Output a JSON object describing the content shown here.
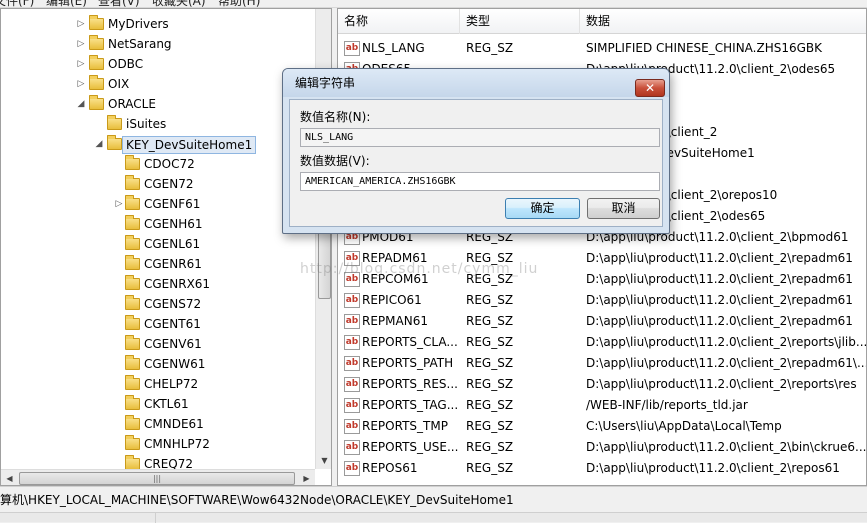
{
  "menu": {
    "items": [
      "文件(F)",
      "编辑(E)",
      "查看(V)",
      "收藏夹(A)",
      "帮助(H)"
    ]
  },
  "tree": {
    "items": [
      {
        "label": "MyDrivers",
        "arrow": "▷"
      },
      {
        "label": "NetSarang",
        "arrow": "▷"
      },
      {
        "label": "ODBC",
        "arrow": "▷"
      },
      {
        "label": "OIX",
        "arrow": "▷"
      },
      {
        "label": "ORACLE",
        "arrow": "◢"
      },
      {
        "label": "iSuites",
        "arrow": ""
      },
      {
        "label": "KEY_DevSuiteHome1",
        "arrow": "◢"
      },
      {
        "label": "CDOC72",
        "arrow": ""
      },
      {
        "label": "CGEN72",
        "arrow": ""
      },
      {
        "label": "CGENF61",
        "arrow": "▷"
      },
      {
        "label": "CGENH61",
        "arrow": ""
      },
      {
        "label": "CGENL61",
        "arrow": ""
      },
      {
        "label": "CGENR61",
        "arrow": ""
      },
      {
        "label": "CGENRX61",
        "arrow": ""
      },
      {
        "label": "CGENS72",
        "arrow": ""
      },
      {
        "label": "CGENT61",
        "arrow": ""
      },
      {
        "label": "CGENV61",
        "arrow": ""
      },
      {
        "label": "CGENW61",
        "arrow": ""
      },
      {
        "label": "CHELP72",
        "arrow": ""
      },
      {
        "label": "CKTL61",
        "arrow": ""
      },
      {
        "label": "CMNDE61",
        "arrow": ""
      },
      {
        "label": "CMNHLP72",
        "arrow": ""
      },
      {
        "label": "CREQ72",
        "arrow": ""
      }
    ],
    "hscroll_grip": "|||"
  },
  "list": {
    "columns": [
      "名称",
      "类型",
      "数据"
    ],
    "rows": [
      {
        "name": "NLS_LANG",
        "type": "REG_SZ",
        "data": "SIMPLIFIED CHINESE_CHINA.ZHS16GBK"
      },
      {
        "name": "ODES65",
        "type": "",
        "data": "D:\\app\\liu\\product\\11.2.0\\client_2\\odes65"
      },
      {
        "name": "",
        "type": "",
        "data": ""
      },
      {
        "name": "",
        "type": "",
        "data": "iteHome1"
      },
      {
        "name": "",
        "type": "",
        "data": "roduct\\11.2.0\\client_2"
      },
      {
        "name": "",
        "type": "",
        "data": "RACLE\\KEY_DevSuiteHome1"
      },
      {
        "name": "",
        "type": "",
        "data": ""
      },
      {
        "name": "",
        "type": "",
        "data": "roduct\\11.2.0\\client_2\\orepos10"
      },
      {
        "name": "",
        "type": "",
        "data": "roduct\\11.2.0\\client_2\\odes65"
      },
      {
        "name": "PMOD61",
        "type": "REG_SZ",
        "data": "D:\\app\\liu\\product\\11.2.0\\client_2\\bpmod61"
      },
      {
        "name": "REPADM61",
        "type": "REG_SZ",
        "data": "D:\\app\\liu\\product\\11.2.0\\client_2\\repadm61"
      },
      {
        "name": "REPCOM61",
        "type": "REG_SZ",
        "data": "D:\\app\\liu\\product\\11.2.0\\client_2\\repadm61"
      },
      {
        "name": "REPICO61",
        "type": "REG_SZ",
        "data": "D:\\app\\liu\\product\\11.2.0\\client_2\\repadm61"
      },
      {
        "name": "REPMAN61",
        "type": "REG_SZ",
        "data": "D:\\app\\liu\\product\\11.2.0\\client_2\\repadm61"
      },
      {
        "name": "REPORTS_CLA...",
        "type": "REG_SZ",
        "data": "D:\\app\\liu\\product\\11.2.0\\client_2\\reports\\jlib..."
      },
      {
        "name": "REPORTS_PATH",
        "type": "REG_SZ",
        "data": "D:\\app\\liu\\product\\11.2.0\\client_2\\repadm61\\..."
      },
      {
        "name": "REPORTS_RES...",
        "type": "REG_SZ",
        "data": "D:\\app\\liu\\product\\11.2.0\\client_2\\reports\\res"
      },
      {
        "name": "REPORTS_TAG...",
        "type": "REG_SZ",
        "data": "/WEB-INF/lib/reports_tld.jar"
      },
      {
        "name": "REPORTS_TMP",
        "type": "REG_SZ",
        "data": "C:\\Users\\liu\\AppData\\Local\\Temp"
      },
      {
        "name": "REPORTS_USE...",
        "type": "REG_SZ",
        "data": "D:\\app\\liu\\product\\11.2.0\\client_2\\bin\\ckrue6..."
      },
      {
        "name": "REPOS61",
        "type": "REG_SZ",
        "data": "D:\\app\\liu\\product\\11.2.0\\client_2\\repos61"
      }
    ],
    "value_icon": "ab"
  },
  "statusbar": {
    "path": "算机\\HKEY_LOCAL_MACHINE\\SOFTWARE\\Wow6432Node\\ORACLE\\KEY_DevSuiteHome1"
  },
  "watermark": "http://blog.csdn.net/cymm_liu",
  "dialog": {
    "title": "编辑字符串",
    "close_glyph": "✕",
    "name_label": "数值名称(N):",
    "name_value": "NLS_LANG",
    "data_label": "数值数据(V):",
    "data_value": "AMERICAN_AMERICA.ZHS16GBK",
    "ok_label": "确定",
    "cancel_label": "取消"
  }
}
